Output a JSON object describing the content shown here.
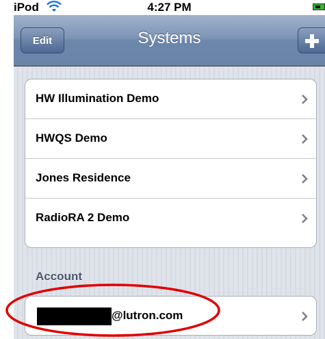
{
  "statusbar": {
    "carrier": "iPod",
    "time": "4:27 PM"
  },
  "navbar": {
    "title": "Systems",
    "edit_label": "Edit",
    "add_icon": "plus-icon"
  },
  "systems": [
    {
      "label": "HW Illumination Demo"
    },
    {
      "label": "HWQS Demo"
    },
    {
      "label": "Jones Residence"
    },
    {
      "label": "RadioRA 2 Demo"
    }
  ],
  "account": {
    "header": "Account",
    "email_visible": "@lutron.com"
  },
  "colors": {
    "navbar": "#7d94b6",
    "background": "#dfe3ea",
    "annotation": "#e00000",
    "battery": "#2fb52f"
  }
}
